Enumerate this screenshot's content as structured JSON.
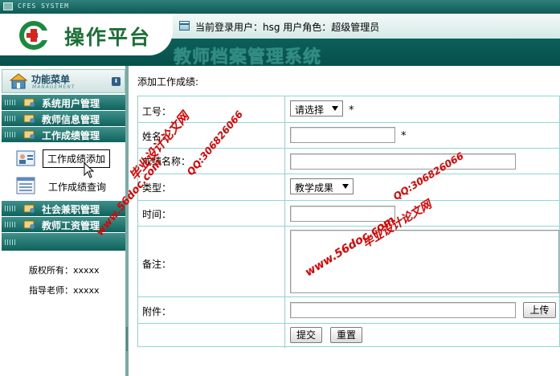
{
  "topbar": {
    "system_code": "CFES SYSTEM"
  },
  "header": {
    "brand_title": "操作平台",
    "system_title": "教师档案管理系统",
    "user_info": "当前登录用户：hsg  用户角色：超级管理员"
  },
  "sidebar": {
    "menu_title": "功能菜单",
    "menu_subtitle": "MANAGEMENT",
    "items": [
      {
        "label": "系统用户管理"
      },
      {
        "label": "教师信息管理"
      },
      {
        "label": "工作成绩管理"
      },
      {
        "label": "社会兼职管理"
      },
      {
        "label": "教师工资管理"
      }
    ],
    "sub_items": [
      {
        "label": "工作成绩添加"
      },
      {
        "label": "工作成绩查询"
      }
    ],
    "copyright": "版权所有：xxxxx",
    "advisor": "指导老师：xxxxx"
  },
  "main": {
    "title": "添加工作成绩:",
    "fields": {
      "worker_id_label": "工号：",
      "worker_id_value": "请选择",
      "name_label": "姓名：",
      "achievement_name_label": "成绩名称：",
      "type_label": "类型：",
      "type_value": "教学成果",
      "time_label": "时间：",
      "remark_label": "备注：",
      "attachment_label": "附件："
    },
    "required_mark": "*",
    "upload_button": "上传",
    "submit_button": "提交",
    "reset_button": "重置"
  },
  "watermarks": {
    "site_url": "www.56doc.com",
    "qq": "QQ:306826066",
    "site_name": "毕业设计论文网"
  },
  "colors": {
    "header_bg": "#0f6d67",
    "menu_item_bg": "#1f726c",
    "table_border": "#8fd6d6",
    "brand_green": "#1a6f35",
    "watermark_red": "#e00000"
  }
}
